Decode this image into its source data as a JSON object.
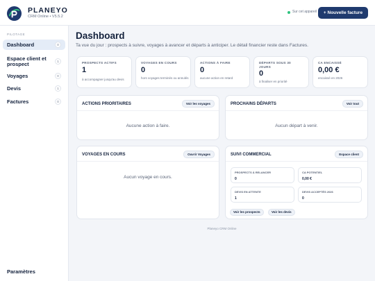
{
  "header": {
    "brand": "PLANEYO",
    "version": "CRM Online • V5.5.2",
    "sync_status": "Sur cet appareil",
    "new_invoice_label": "+ Nouvelle facture",
    "colors": {
      "primary": "#1f3a6e",
      "sync": "#2ec27e"
    }
  },
  "sidebar": {
    "section": "PILOTAGE",
    "items": [
      {
        "label": "Dashboard",
        "count": "0"
      },
      {
        "label": "Espace client et prospect",
        "count": "1"
      },
      {
        "label": "Voyages",
        "count": "0"
      },
      {
        "label": "Devis",
        "count": "1"
      },
      {
        "label": "Factures",
        "count": "0"
      }
    ],
    "settings": "Paramètres"
  },
  "main": {
    "title": "Dashboard",
    "subtitle": "Ta vue du jour : prospects à suivre, voyages à avancer et départs à anticiper. Le détail financier reste dans Factures.",
    "kpis": [
      {
        "label": "PROSPECTS ACTIFS",
        "value": "1",
        "hint": "à accompagner jusqu'au devis"
      },
      {
        "label": "VOYAGES EN COURS",
        "value": "0",
        "hint": "hors voyages terminés ou annulés"
      },
      {
        "label": "ACTIONS À FAIRE",
        "value": "0",
        "hint": "aucune action en retard"
      },
      {
        "label": "DÉPARTS SOUS 30 JOURS",
        "value": "0",
        "hint": "à finaliser en priorité"
      },
      {
        "label": "CA ENCAISSÉ",
        "value": "0,00 €",
        "hint": "encaissé en 2026"
      }
    ],
    "actions": {
      "title": "ACTIONS PRIORITAIRES",
      "button": "Voir les voyages",
      "empty": "Aucune action à faire."
    },
    "departures": {
      "title": "PROCHAINS DÉPARTS",
      "button": "Voir tout",
      "empty": "Aucun départ à venir."
    },
    "trips": {
      "title": "VOYAGES EN COURS",
      "button": "Ouvrir Voyages",
      "empty": "Aucun voyage en cours."
    },
    "commercial": {
      "title": "SUIVI COMMERCIAL",
      "button": "Espace client",
      "stats": [
        {
          "label": "PROSPECTS À RELANCER",
          "value": "0"
        },
        {
          "label": "CA POTENTIEL",
          "value": "0,00 €"
        },
        {
          "label": "DEVIS EN ATTENTE",
          "value": "1"
        },
        {
          "label": "DEVIS ACCEPTÉS 2026",
          "value": "0"
        }
      ],
      "prospects_button": "Voir les prospects",
      "quotes_button": "Voir les devis"
    }
  },
  "footer": "Planeyo CRM Online"
}
